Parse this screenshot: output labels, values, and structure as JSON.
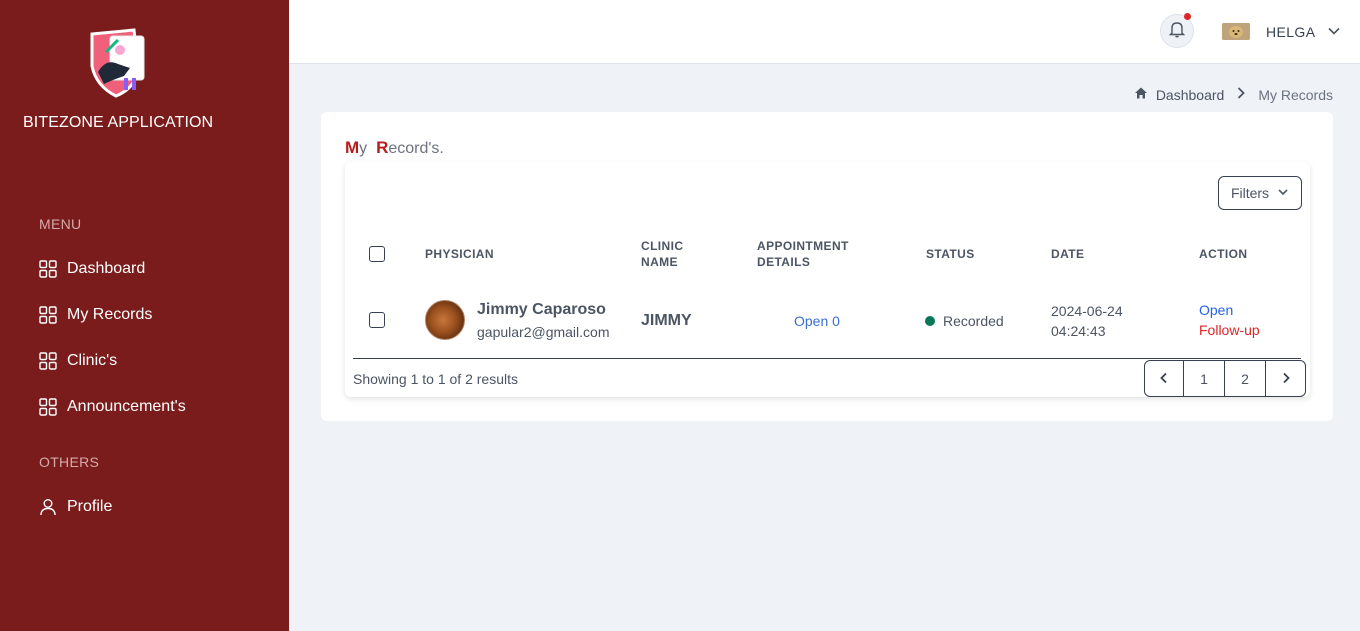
{
  "sidebar": {
    "app_name": "BITEZONE APPLICATION",
    "menu_label": "MENU",
    "others_label": "OTHERS",
    "menu_items": [
      {
        "label": "Dashboard",
        "icon": "grid-icon"
      },
      {
        "label": "My Records",
        "icon": "grid-icon"
      },
      {
        "label": "Clinic's",
        "icon": "grid-icon"
      },
      {
        "label": "Announcement's",
        "icon": "grid-icon"
      }
    ],
    "other_items": [
      {
        "label": "Profile",
        "icon": "user-icon"
      }
    ],
    "background": "#7a1c1c"
  },
  "header": {
    "user_name": "HELGA",
    "notification_icon": "bell-icon",
    "has_notification": true
  },
  "breadcrumb": {
    "home": "Dashboard",
    "current": "My Records"
  },
  "card": {
    "title_cap1": "M",
    "title_rest1": "y",
    "title_cap2": "R",
    "title_rest2": "ecord's.",
    "filters_label": "Filters",
    "columns": {
      "physician": "PHYSICIAN",
      "clinic_1": "CLINIC",
      "clinic_2": "NAME",
      "appointment_1": "APPOINTMENT",
      "appointment_2": "DETAILS",
      "status": "STATUS",
      "date": "DATE",
      "action": "ACTION"
    },
    "rows": [
      {
        "physician_name": "Jimmy Caparoso",
        "physician_email": "gapular2@gmail.com",
        "clinic": "JIMMY",
        "appointment": "Open 0",
        "status": "Recorded",
        "status_color": "#047857",
        "date": "2024-06-24",
        "time": "04:24:43",
        "action_open": "Open",
        "action_followup": "Follow-up"
      }
    ],
    "showing": "Showing 1 to 1 of 2 results",
    "pages": [
      "1",
      "2"
    ]
  }
}
